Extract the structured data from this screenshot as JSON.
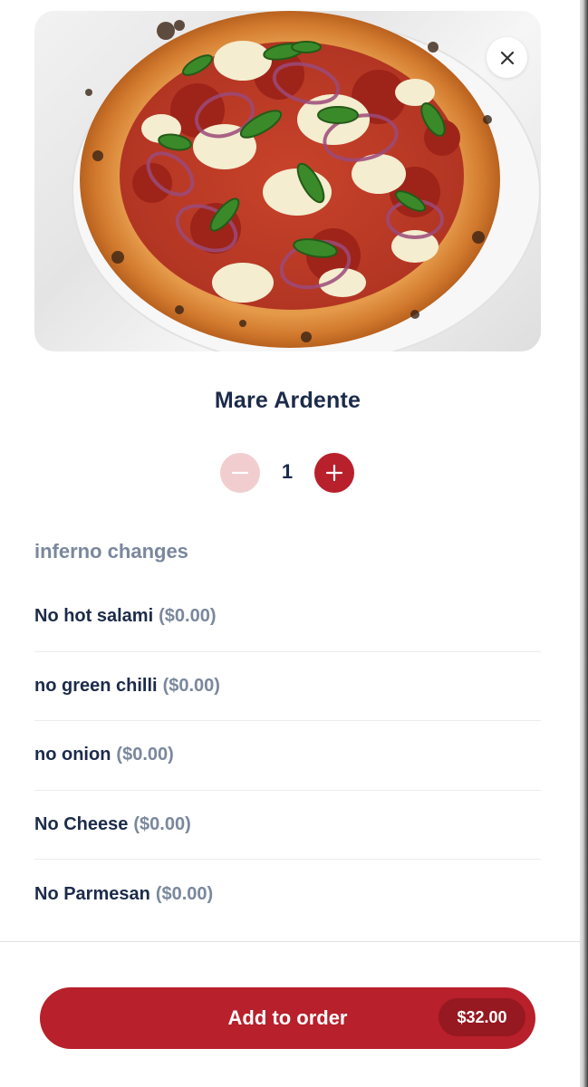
{
  "product": {
    "image_alt": "pizza-photo",
    "name": "Mare Ardente"
  },
  "quantity": {
    "value": "1",
    "minus_icon": "minus-icon",
    "plus_icon": "plus-icon"
  },
  "modifiers": {
    "group_title": "inferno changes",
    "options": [
      {
        "name": "No hot salami",
        "price": "($0.00)"
      },
      {
        "name": "no green chilli",
        "price": "($0.00)"
      },
      {
        "name": "no onion",
        "price": "($0.00)"
      },
      {
        "name": "No Cheese",
        "price": "($0.00)"
      },
      {
        "name": "No Parmesan",
        "price": "($0.00)"
      }
    ]
  },
  "footer": {
    "add_label": "Add to order",
    "total": "$32.00"
  },
  "colors": {
    "brand_red": "#b8202b",
    "brand_red_dark": "#961820",
    "minus_disabled": "#f1cdd0",
    "heading_navy": "#1c2b4a",
    "muted_gray": "#7a879d"
  },
  "icons": {
    "close": "close-icon"
  }
}
